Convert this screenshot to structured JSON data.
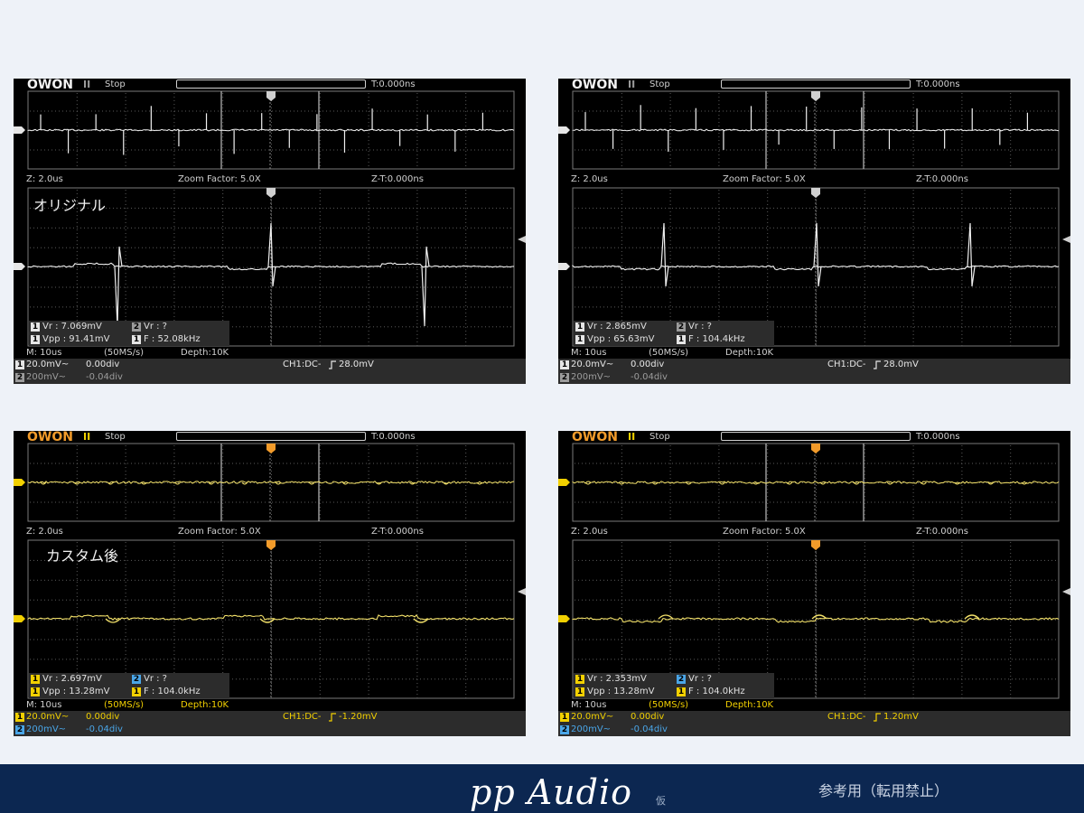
{
  "footer": {
    "brand": "pp Audio",
    "brand_suffix": "仮",
    "note": "参考用（転用禁止）"
  },
  "scopes": [
    {
      "id": "tl",
      "theme": "white",
      "label": "オリジナル",
      "logo": "OWON",
      "run_state": "Stop",
      "t_offset": "T:0.000ns",
      "zoom_scale": "Z: 2.0us",
      "zoom_factor": "Zoom Factor: 5.0X",
      "zt_offset": "Z-T:0.000ns",
      "m1_label": "Vr : 7.069mV",
      "m2_label": "Vr :   ?",
      "m3_label": "Vpp : 91.41mV",
      "m4_label": "F : 52.08kHz",
      "timebase": "M: 10us",
      "sample_rate": "(50MS/s)",
      "depth": "Depth:10K",
      "ch1_scale": "20.0mV~",
      "ch1_pos": "0.00div",
      "ch2_scale": "200mV~",
      "ch2_pos": "-0.04div",
      "trigger": "CH1:DC-",
      "trigger_level": "28.0mV",
      "spike_x": [
        130,
        300,
        470
      ],
      "spike_main": [
        -1,
        1,
        -1
      ]
    },
    {
      "id": "tr",
      "theme": "white",
      "label": "",
      "logo": "OWON",
      "run_state": "Stop",
      "t_offset": "T:0.000ns",
      "zoom_scale": "Z: 2.0us",
      "zoom_factor": "Zoom Factor: 5.0X",
      "zt_offset": "Z-T:0.000ns",
      "m1_label": "Vr : 2.865mV",
      "m2_label": "Vr :   ?",
      "m3_label": "Vpp : 65.63mV",
      "m4_label": "F : 104.4kHz",
      "timebase": "M: 10us",
      "sample_rate": "(50MS/s)",
      "depth": "Depth:10K",
      "ch1_scale": "20.0mV~",
      "ch1_pos": "0.00div",
      "ch2_scale": "200mV~",
      "ch2_pos": "-0.04div",
      "trigger": "CH1:DC-",
      "trigger_level": "28.0mV",
      "spike_x": [
        735,
        904,
        1074
      ],
      "spike_main": [
        1,
        1,
        1
      ]
    },
    {
      "id": "bl",
      "theme": "yellow",
      "label": "カスタム後",
      "logo": "OWON",
      "run_state": "Stop",
      "t_offset": "T:0.000ns",
      "zoom_scale": "Z: 2.0us",
      "zoom_factor": "Zoom Factor: 5.0X",
      "zt_offset": "Z-T:0.000ns",
      "m1_label": "Vr : 2.697mV",
      "m2_label": "Vr :   ?",
      "m3_label": "Vpp : 13.28mV",
      "m4_label": "F : 104.0kHz",
      "timebase": "M: 10us",
      "sample_rate": "(50MS/s)",
      "depth": "Depth:10K",
      "ch1_scale": "20.0mV~",
      "ch1_pos": "0.00div",
      "ch2_scale": "200mV~",
      "ch2_pos": "-0.04div",
      "trigger": "CH1:DC-",
      "trigger_level": "-1.20mV",
      "spike_x": [
        125,
        296,
        466
      ],
      "spike_main": [
        -1,
        -1,
        -1
      ]
    },
    {
      "id": "br",
      "theme": "yellow",
      "label": "",
      "logo": "OWON",
      "run_state": "Stop",
      "t_offset": "T:0.000ns",
      "zoom_scale": "Z: 2.0us",
      "zoom_factor": "Zoom Factor: 5.0X",
      "zt_offset": "Z-T:0.000ns",
      "m1_label": "Vr : 2.353mV",
      "m2_label": "Vr :   ?",
      "m3_label": "Vpp : 13.28mV",
      "m4_label": "F : 104.0kHz",
      "timebase": "M: 10us",
      "sample_rate": "(50MS/s)",
      "depth": "Depth:10K",
      "ch1_scale": "20.0mV~",
      "ch1_pos": "0.00div",
      "ch2_scale": "200mV~",
      "ch2_pos": "-0.04div",
      "trigger": "CH1:DC-",
      "trigger_level": "1.20mV",
      "spike_x": [
        737,
        907,
        1076
      ],
      "spike_main": [
        1,
        1,
        1
      ]
    }
  ],
  "colors": {
    "white_trace": "#f0f0f0",
    "yellow_trace": "#f3e16a",
    "logo_white": "#f2f2f2",
    "logo_yellow": "#f29b2a",
    "run_white": "#9a9a9a",
    "run_yellow": "#f0d000",
    "ch1_white": "#e6e6e6",
    "ch1_yellow": "#f2d000",
    "ch2_white": "#9c9c9c",
    "ch2_yellow": "#4aa6e8",
    "footer_bg": "#0c2751"
  }
}
